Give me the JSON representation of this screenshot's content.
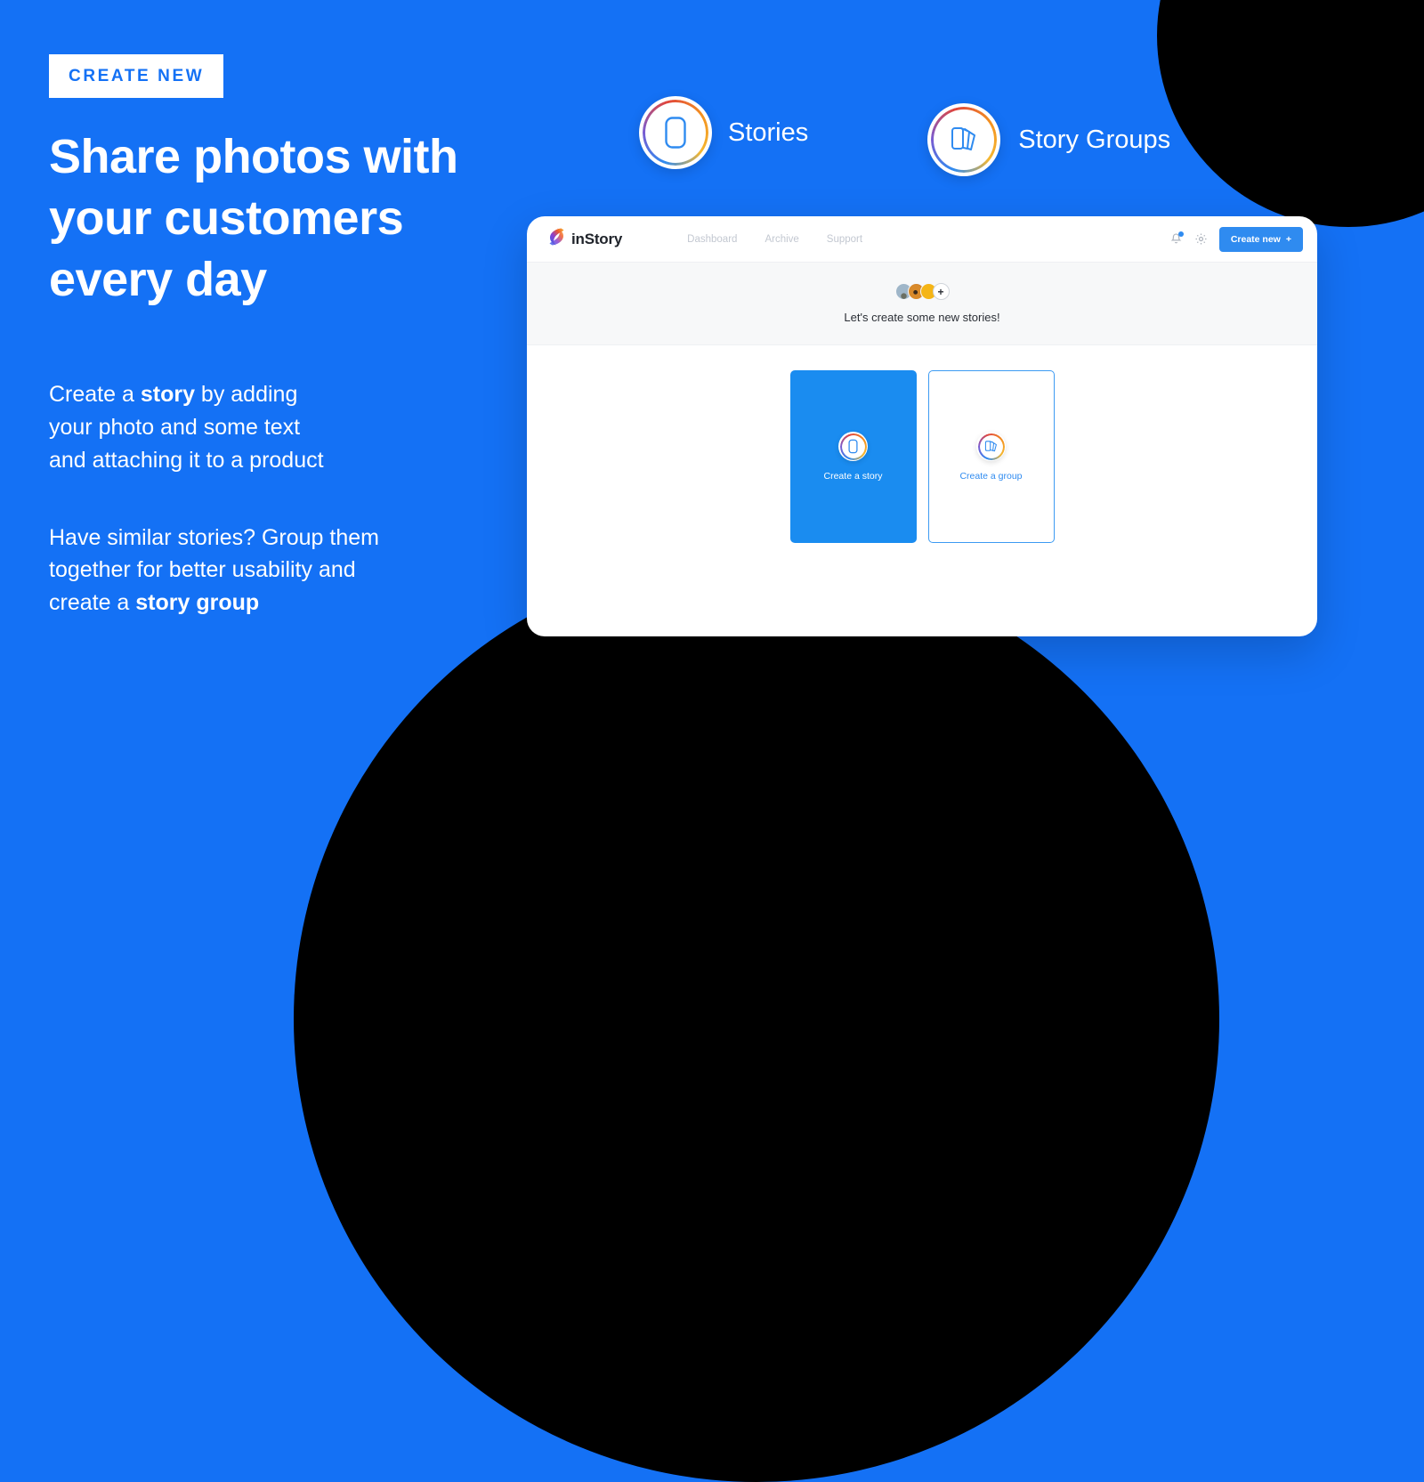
{
  "theme": {
    "background_blue": "#1471f5",
    "accent_blue": "#2f8bf0",
    "card_blue": "#1a8cf0",
    "shape_black": "#000000",
    "banner_gray": "#f7f8f9"
  },
  "promo": {
    "eyebrow": "CREATE NEW",
    "headline_lines": [
      "Share photos with",
      "your customers",
      "every day"
    ],
    "paragraph_1": {
      "part_1": "Create a ",
      "bold_1": "story",
      "part_2": " by adding",
      "line_2": "your photo and some text",
      "line_3": "and attaching it to a product"
    },
    "paragraph_2": {
      "line_1": "Have similar stories? Group them",
      "line_2": "together for better usability and",
      "part_3": "create a ",
      "bold_3": "story group"
    }
  },
  "badges": [
    {
      "label": "Stories",
      "icon": "story-phone-icon"
    },
    {
      "label": "Story Groups",
      "icon": "story-group-cards-icon"
    }
  ],
  "app": {
    "logo_name": "inStory",
    "logo_icon": "instory-swirl-logo-icon",
    "nav": [
      {
        "label": "Dashboard"
      },
      {
        "label": "Archive"
      },
      {
        "label": "Support"
      }
    ],
    "header_actions": {
      "bell_icon": "notification-bell-icon",
      "gear_icon": "settings-gear-icon",
      "create_label": "Create new",
      "create_plus": "+"
    },
    "banner": {
      "message": "Let's create some new stories!",
      "avatar_count": 3,
      "add_label": "+"
    },
    "cards": [
      {
        "label": "Create a story",
        "icon": "story-phone-icon",
        "style": "filled"
      },
      {
        "label": "Create a group",
        "icon": "story-group-cards-icon",
        "style": "outlined"
      }
    ]
  }
}
